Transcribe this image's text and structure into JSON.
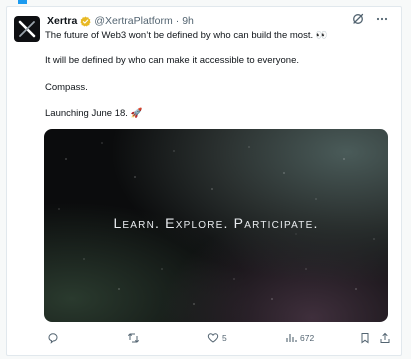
{
  "post": {
    "author_name": "Xertra",
    "handle": "@XertraPlatform",
    "separator": "·",
    "time": "9h",
    "paragraphs": [
      "The future of Web3 won’t be defined by who can build the most. 👀",
      "It will be defined by who can make it accessible to everyone.",
      "Compass.",
      "Launching June 18. 🚀"
    ],
    "media_text": "Learn. Explore. Participate.",
    "actions": {
      "reply_count": "",
      "repost_count": "",
      "like_count": "5",
      "views_count": "672"
    }
  },
  "colors": {
    "accent": "#1d9bf0",
    "verified_gold": "#e8b923",
    "muted": "#536471"
  },
  "icons": [
    "grok-icon",
    "more-icon",
    "reply-icon",
    "repost-icon",
    "like-icon",
    "views-icon",
    "share-icon"
  ]
}
